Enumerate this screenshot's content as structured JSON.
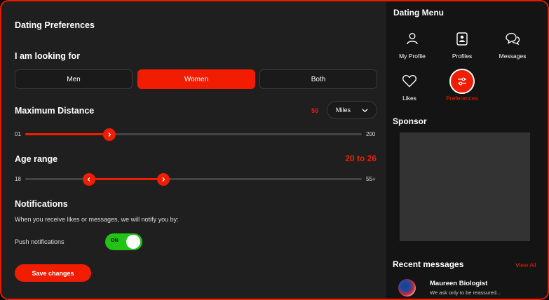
{
  "prefs": {
    "title": "Dating Preferences",
    "looking_for_label": "I am looking for",
    "options": [
      "Men",
      "Women",
      "Both"
    ],
    "selected_option": "Women",
    "distance": {
      "label": "Maximum Distance",
      "value": "50",
      "unit": "Miles",
      "min_label": "01",
      "max_label": "200",
      "fraction": 0.25
    },
    "age": {
      "label": "Age range",
      "value_text": "20 to 26",
      "min_label": "18",
      "max_label": "55+",
      "low_fraction": 0.19,
      "high_fraction": 0.41
    },
    "notifications": {
      "title": "Notifications",
      "desc": "When you receive likes or messages, we will notify you by:",
      "push_label": "Push notifications",
      "toggle_text": "ON",
      "enabled": true
    },
    "save_label": "Save changes"
  },
  "menu": {
    "title": "Dating Menu",
    "items": [
      {
        "label": "My Profile",
        "icon": "user-icon"
      },
      {
        "label": "Profiles",
        "icon": "profile-card-icon"
      },
      {
        "label": "Messages",
        "icon": "chat-bubbles-icon"
      },
      {
        "label": "Likes",
        "icon": "heart-icon"
      },
      {
        "label": "Preferences",
        "icon": "sliders-icon",
        "active": true
      }
    ]
  },
  "sponsor": {
    "title": "Sponsor"
  },
  "recent": {
    "title": "Recent messages",
    "view_all": "View All",
    "messages": [
      {
        "name": "Maureen Biologist",
        "preview": "We ask only to be reassured..."
      }
    ]
  },
  "colors": {
    "accent": "#f21d00",
    "toggle_on": "#22c216",
    "background": "#1f1f1f",
    "sidebar": "#141414"
  }
}
